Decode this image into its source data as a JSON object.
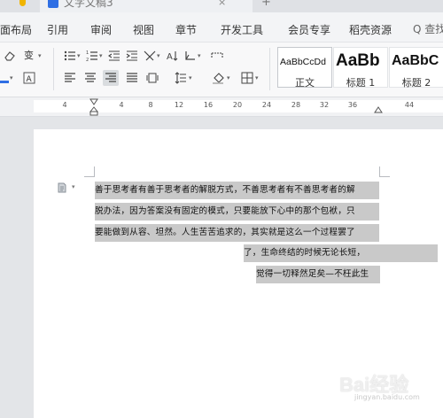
{
  "tabs": {
    "document_title": "文字文稿3",
    "close_glyph": "×",
    "new_tab_glyph": "+"
  },
  "menu": {
    "items": [
      "面布局",
      "引用",
      "审阅",
      "视图",
      "章节",
      "开发工具",
      "会员专享",
      "稻壳资源"
    ],
    "search": "Q 查找"
  },
  "ribbon": {
    "styles": [
      {
        "sample": "AaBbCcDd",
        "name": "正文"
      },
      {
        "sample": "AaBb",
        "name": "标题 1"
      },
      {
        "sample": "AaBbC",
        "name": "标题 2"
      }
    ]
  },
  "ruler": {
    "ticks": [
      "4",
      "4",
      "8",
      "12",
      "16",
      "20",
      "24",
      "28",
      "32",
      "36",
      "44"
    ]
  },
  "document": {
    "lines": [
      "善于思考者有善于思考者的解脱方式，不善思考者有不善思考者的解",
      "脱办法，因为答案没有固定的模式，只要能放下心中的那个包袱，只",
      "要能做到从容、坦然。人生苦苦追求的，其实就是这么一个过程罢了",
      "了，生命终结的时候无论长短，",
      "觉得一切释然足矣—不枉此生"
    ]
  },
  "watermark": {
    "text": "Bai经验",
    "sub": "jingyan.baidu.com"
  },
  "colors": {
    "selection": "#c9c9c9",
    "accent": "#2f6fe4"
  }
}
